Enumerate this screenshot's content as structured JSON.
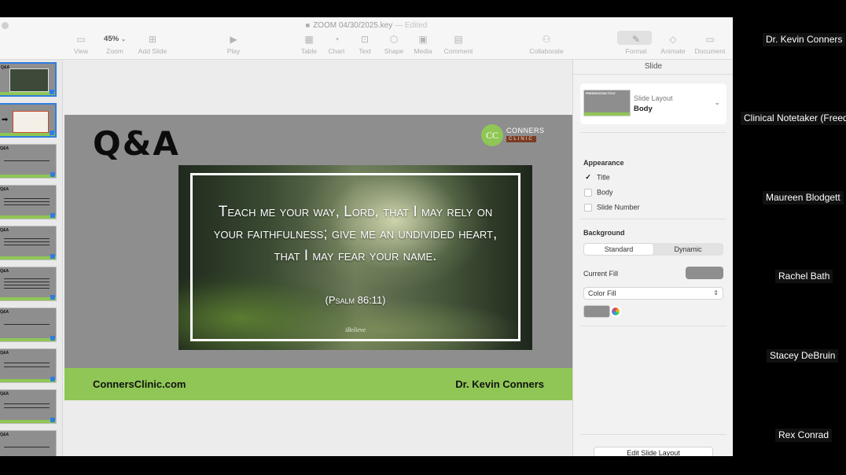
{
  "window": {
    "title": "ZOOM 04/30/2025.key",
    "edited_label": "— Edited"
  },
  "toolbar": {
    "view": "View",
    "zoom_value": "45%",
    "zoom": "Zoom",
    "add_slide": "Add Slide",
    "play": "Play",
    "table": "Table",
    "chart": "Chart",
    "text": "Text",
    "shape": "Shape",
    "media": "Media",
    "comment": "Comment",
    "collaborate": "Collaborate",
    "format": "Format",
    "animate": "Animate",
    "document": "Document"
  },
  "navigator": {
    "thumb_title": "Q&A",
    "count": 10
  },
  "slide": {
    "title": "Q&A",
    "logo_top": "CONNERS",
    "logo_bottom": "CLINIC",
    "logo_mark": "CC",
    "verse": "Teach me your way, Lord, that I may rely on your faithfulness; give me an undivided heart, that I may fear your name.",
    "reference": "(Psalm 86:11)",
    "watermark": "iBelieve",
    "footer_left": "ConnersClinic.com",
    "footer_right": "Dr. Kevin Conners"
  },
  "inspector": {
    "tab": "Slide",
    "layout_label": "Slide Layout",
    "layout_value": "Body",
    "layout_thumb_title": "PRESENTATION TITLE",
    "appearance_head": "Appearance",
    "opt_title": "Title",
    "opt_body": "Body",
    "opt_slide_number": "Slide Number",
    "background_head": "Background",
    "seg_standard": "Standard",
    "seg_dynamic": "Dynamic",
    "current_fill": "Current Fill",
    "fill_type": "Color Fill",
    "edit_layout": "Edit Slide Layout",
    "fill_color": "#8e8e8e"
  },
  "participants": [
    "Dr. Kevin Conners",
    "Clinical Notetaker (Freed",
    "Maureen Blodgett",
    "Rachel Bath",
    "Stacey DeBruin",
    "Rex Conrad"
  ],
  "colors": {
    "brand_green": "#8fc655",
    "selection_blue": "#2f7de1",
    "slide_gray": "#8e8e8e"
  }
}
